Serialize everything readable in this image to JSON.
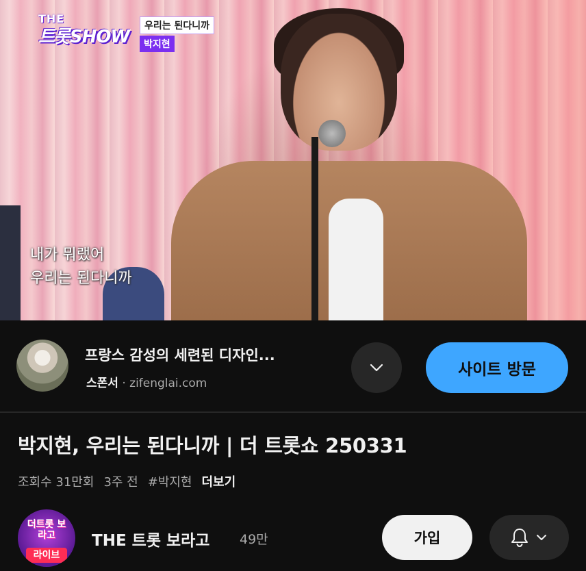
{
  "video": {
    "logo_top": "THE",
    "logo_bottom": "트롯SHOW",
    "song_title_tag": "우리는 된다니까",
    "singer_tag": "박지현",
    "subtitle_line1": "내가 뭐랬어",
    "subtitle_line2": "우리는 된다니까"
  },
  "ad": {
    "title": "프랑스 감성의 세련된 디자인...",
    "sponsor_label": "스폰서",
    "separator": "·",
    "domain": "zifenglai.com",
    "expand_icon": "chevron-down-icon",
    "visit_label": "사이트 방문",
    "accent": "#3ea6ff"
  },
  "video_info": {
    "title": "박지현, 우리는 된다니까 | 더 트롯쇼 250331",
    "views": "조회수 31만회",
    "age": "3주 전",
    "hashtag": "#박지현",
    "more_label": "더보기"
  },
  "channel": {
    "avatar_text": "더트롯 보라고",
    "avatar_badge": "라이브",
    "name": "THE 트롯 보라고",
    "subscribers": "49만",
    "join_label": "가입",
    "bell_icon": "bell-icon",
    "dropdown_icon": "chevron-down-icon"
  },
  "colors": {
    "background": "#0f0f0f",
    "button_dark": "#272727",
    "text_primary": "#f1f1f1",
    "text_secondary": "#aaaaaa"
  }
}
